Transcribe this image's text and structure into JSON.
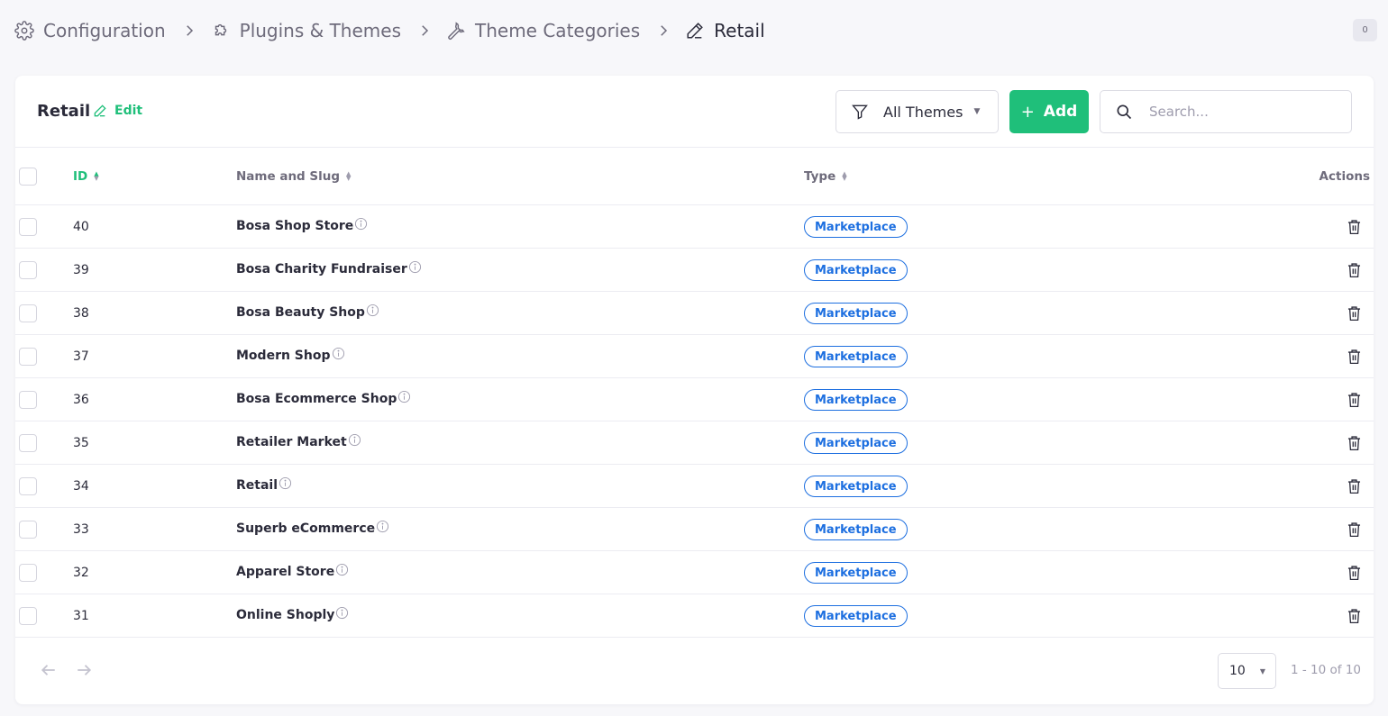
{
  "breadcrumb": [
    {
      "label": "Configuration",
      "icon": "gear-icon"
    },
    {
      "label": "Plugins & Themes",
      "icon": "puzzle-icon"
    },
    {
      "label": "Theme Categories",
      "icon": "wrench-icon"
    },
    {
      "label": "Retail",
      "icon": "pencil-icon"
    }
  ],
  "notifications": {
    "count": "0"
  },
  "header": {
    "title": "Retail",
    "edit_label": "Edit",
    "filter_label": "All Themes",
    "add_label": "Add",
    "search_placeholder": "Search..."
  },
  "table": {
    "columns": {
      "id": "ID",
      "name": "Name and Slug",
      "type": "Type",
      "actions": "Actions"
    },
    "rows": [
      {
        "id": "40",
        "name": "Bosa Shop Store",
        "type": "Marketplace"
      },
      {
        "id": "39",
        "name": "Bosa Charity Fundraiser",
        "type": "Marketplace"
      },
      {
        "id": "38",
        "name": "Bosa Beauty Shop",
        "type": "Marketplace"
      },
      {
        "id": "37",
        "name": "Modern Shop",
        "type": "Marketplace"
      },
      {
        "id": "36",
        "name": "Bosa Ecommerce Shop",
        "type": "Marketplace"
      },
      {
        "id": "35",
        "name": "Retailer Market",
        "type": "Marketplace"
      },
      {
        "id": "34",
        "name": "Retail",
        "type": "Marketplace"
      },
      {
        "id": "33",
        "name": "Superb eCommerce",
        "type": "Marketplace"
      },
      {
        "id": "32",
        "name": "Apparel Store",
        "type": "Marketplace"
      },
      {
        "id": "31",
        "name": "Online Shoply",
        "type": "Marketplace"
      }
    ]
  },
  "pagination": {
    "page_size": "10",
    "range": "1 - 10 of 10"
  },
  "colors": {
    "accent": "#1fbf7a",
    "badge": "#1d6fe0",
    "background": "#f7f7fa"
  }
}
